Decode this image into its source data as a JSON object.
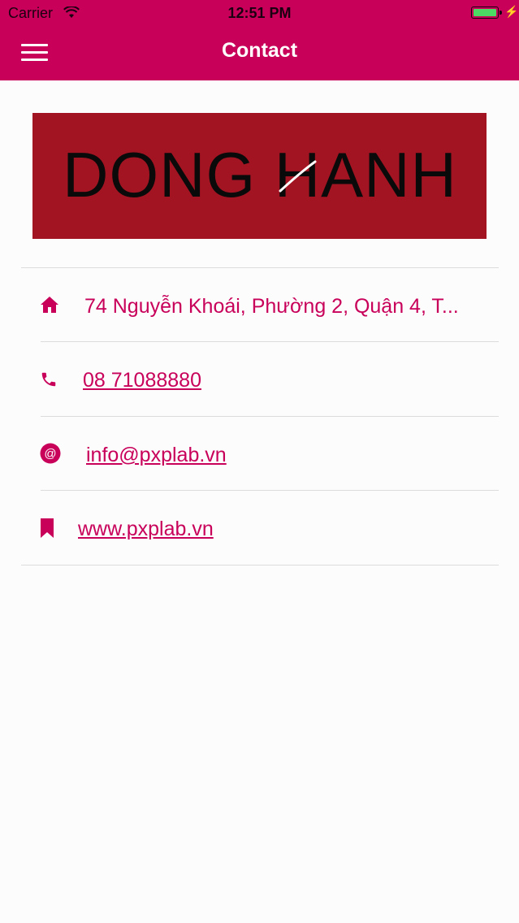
{
  "status_bar": {
    "carrier": "Carrier",
    "time": "12:51 PM"
  },
  "header": {
    "title": "Contact",
    "menu_icon": "hamburger-menu-icon"
  },
  "logo": {
    "text": "DONG HANH",
    "background": "#a31422"
  },
  "contacts": {
    "address": {
      "icon": "home-icon",
      "text": "74 Nguyễn Khoái, Phường 2, Quận 4, T..."
    },
    "phone": {
      "icon": "phone-icon",
      "text": "08 71088880"
    },
    "email": {
      "icon": "at-sign-icon",
      "text": "info@pxplab.vn"
    },
    "website": {
      "icon": "bookmark-icon",
      "text": "www.pxplab.vn"
    }
  },
  "colors": {
    "accent": "#c8005a",
    "background": "#fcfcfc",
    "divider": "#dcdcdc"
  }
}
